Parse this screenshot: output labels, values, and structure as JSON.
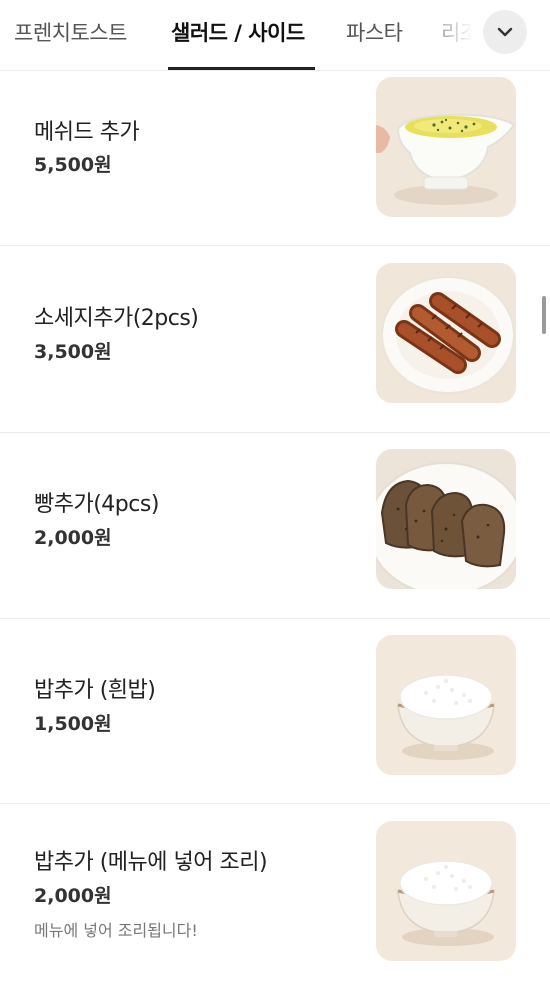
{
  "tabs": [
    {
      "label": "프렌치토스트",
      "active": false
    },
    {
      "label": "샐러드 / 사이드",
      "active": true
    },
    {
      "label": "파스타",
      "active": false
    },
    {
      "label": "리조",
      "active": false
    }
  ],
  "more_icon": "chevron-down-icon",
  "items": [
    {
      "name": "메쉬드 추가",
      "price": "5,500원",
      "description": "",
      "image": "mashed-potato-sauce-boat"
    },
    {
      "name": "소세지추가(2pcs)",
      "price": "3,500원",
      "description": "",
      "image": "sausages-on-plate"
    },
    {
      "name": "빵추가(4pcs)",
      "price": "2,000원",
      "description": "",
      "image": "rye-bread-slices-on-plate"
    },
    {
      "name": "밥추가 (흰밥)",
      "price": "1,500원",
      "description": "",
      "image": "white-rice-bowl"
    },
    {
      "name": "밥추가 (메뉴에 넣어 조리)",
      "price": "2,000원",
      "description": "메뉴에 넣어 조리됩니다!",
      "image": "white-rice-bowl"
    }
  ],
  "colors": {
    "text": "#222222",
    "divider": "#ececec",
    "muted": "#777777",
    "thumb_bg": "#f3e8dc"
  }
}
